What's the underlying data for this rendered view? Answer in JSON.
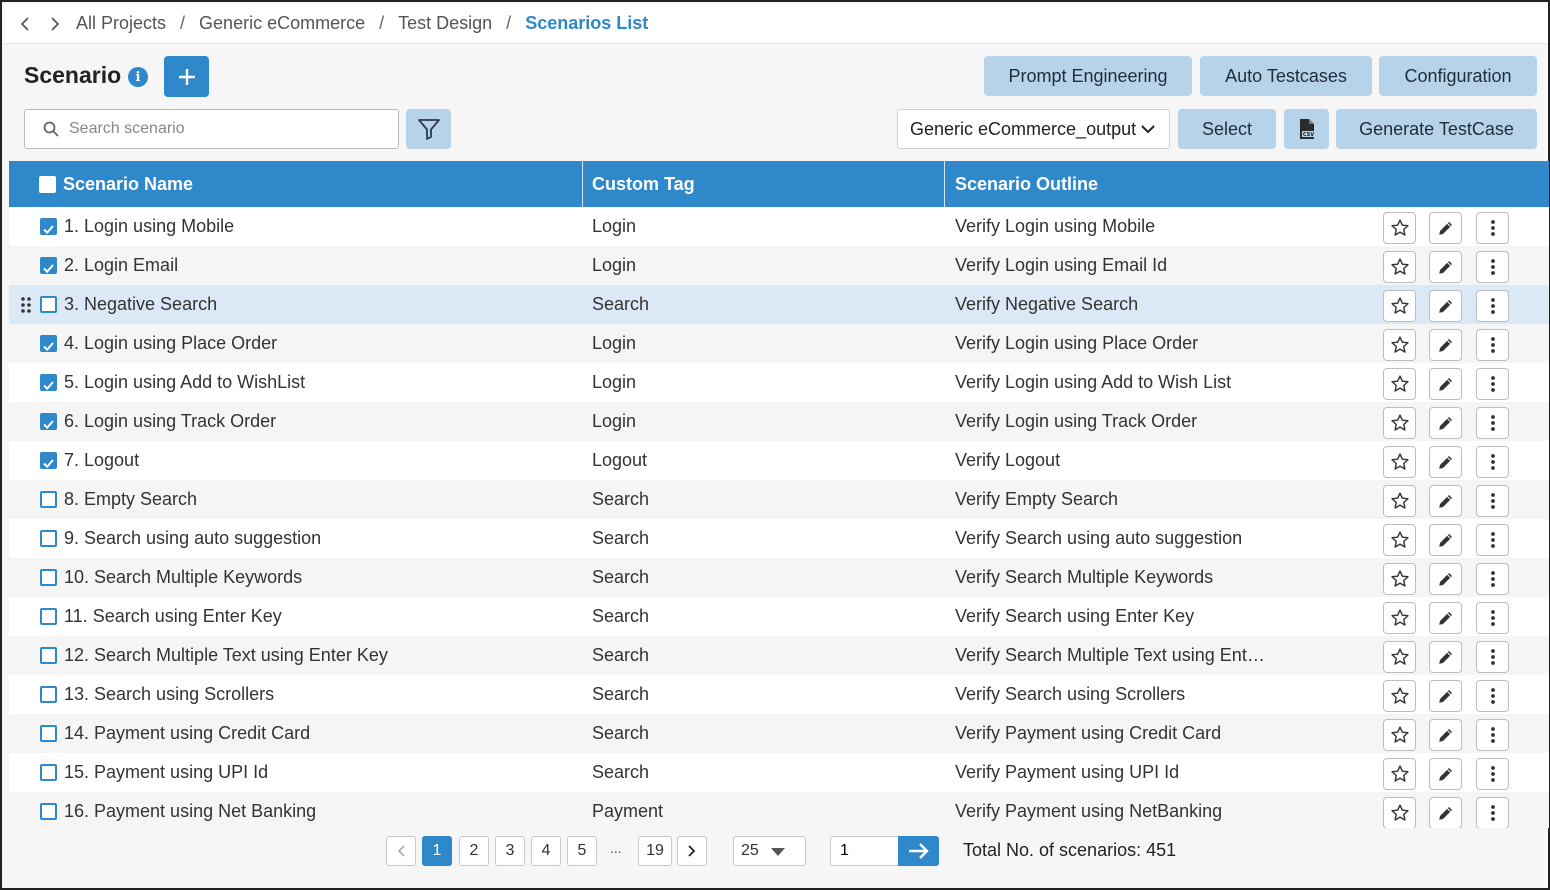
{
  "breadcrumb": {
    "items": [
      "All Projects",
      "Generic eCommerce",
      "Test Design"
    ],
    "current": "Scenarios List",
    "separator": "/"
  },
  "header": {
    "title": "Scenario",
    "info_glyph": "i",
    "add_glyph": "+"
  },
  "top_buttons": {
    "prompt_engineering": "Prompt Engineering",
    "auto_testcases": "Auto Testcases",
    "configuration": "Configuration"
  },
  "search": {
    "placeholder": "Search scenario",
    "value": ""
  },
  "output_select": {
    "value": "Generic eCommerce_output"
  },
  "toolbar": {
    "select_label": "Select",
    "generate_label": "Generate TestCase",
    "csv_icon": "csv-file-icon"
  },
  "table": {
    "columns": [
      "Scenario Name",
      "Custom Tag",
      "Scenario Outline"
    ],
    "rows": [
      {
        "name": "1. Login using Mobile",
        "tag": "Login",
        "outline": "Verify Login using Mobile",
        "checked": true
      },
      {
        "name": "2. Login Email",
        "tag": "Login",
        "outline": "Verify Login using Email Id",
        "checked": true
      },
      {
        "name": "3. Negative Search",
        "tag": "Search",
        "outline": "Verify Negative Search",
        "checked": false,
        "highlighted": true
      },
      {
        "name": "4. Login using Place Order",
        "tag": "Login",
        "outline": "Verify Login using Place Order",
        "checked": true
      },
      {
        "name": "5. Login using Add to WishList",
        "tag": "Login",
        "outline": "Verify Login using Add to Wish List",
        "checked": true
      },
      {
        "name": "6. Login using Track Order",
        "tag": "Login",
        "outline": "Verify Login using Track Order",
        "checked": true
      },
      {
        "name": "7. Logout",
        "tag": "Logout",
        "outline": "Verify Logout",
        "checked": true
      },
      {
        "name": "8. Empty Search",
        "tag": "Search",
        "outline": "Verify Empty Search",
        "checked": false
      },
      {
        "name": "9. Search using auto suggestion",
        "tag": "Search",
        "outline": "Verify Search using auto suggestion",
        "checked": false
      },
      {
        "name": "10. Search Multiple Keywords",
        "tag": "Search",
        "outline": "Verify Search Multiple Keywords",
        "checked": false
      },
      {
        "name": "11. Search using Enter Key",
        "tag": "Search",
        "outline": "Verify Search using Enter Key",
        "checked": false
      },
      {
        "name": "12. Search Multiple Text using Enter Key",
        "tag": "Search",
        "outline": "Verify Search Multiple Text using Ent…",
        "checked": false
      },
      {
        "name": "13. Search using Scrollers",
        "tag": "Search",
        "outline": "Verify Search using Scrollers",
        "checked": false
      },
      {
        "name": "14. Payment using Credit Card",
        "tag": "Search",
        "outline": "Verify Payment using Credit Card",
        "checked": false
      },
      {
        "name": "15. Payment using UPI Id",
        "tag": "Search",
        "outline": "Verify Payment using UPI Id",
        "checked": false
      },
      {
        "name": "16. Payment using Net Banking",
        "tag": "Payment",
        "outline": "Verify Payment using NetBanking",
        "checked": false
      }
    ],
    "row_actions": [
      "star-icon",
      "pencil-icon",
      "more-vertical-icon"
    ]
  },
  "pagination": {
    "pages": [
      "1",
      "2",
      "3",
      "4",
      "5"
    ],
    "ellipsis": "...",
    "last_page": "19",
    "current_page": "1",
    "page_size": "25",
    "goto_value": "1",
    "total_label": "Total No. of scenarios: 451"
  },
  "colors": {
    "primary": "#2f88c9",
    "button_light": "#b6d3ea",
    "row_highlight": "#dae9f5"
  }
}
